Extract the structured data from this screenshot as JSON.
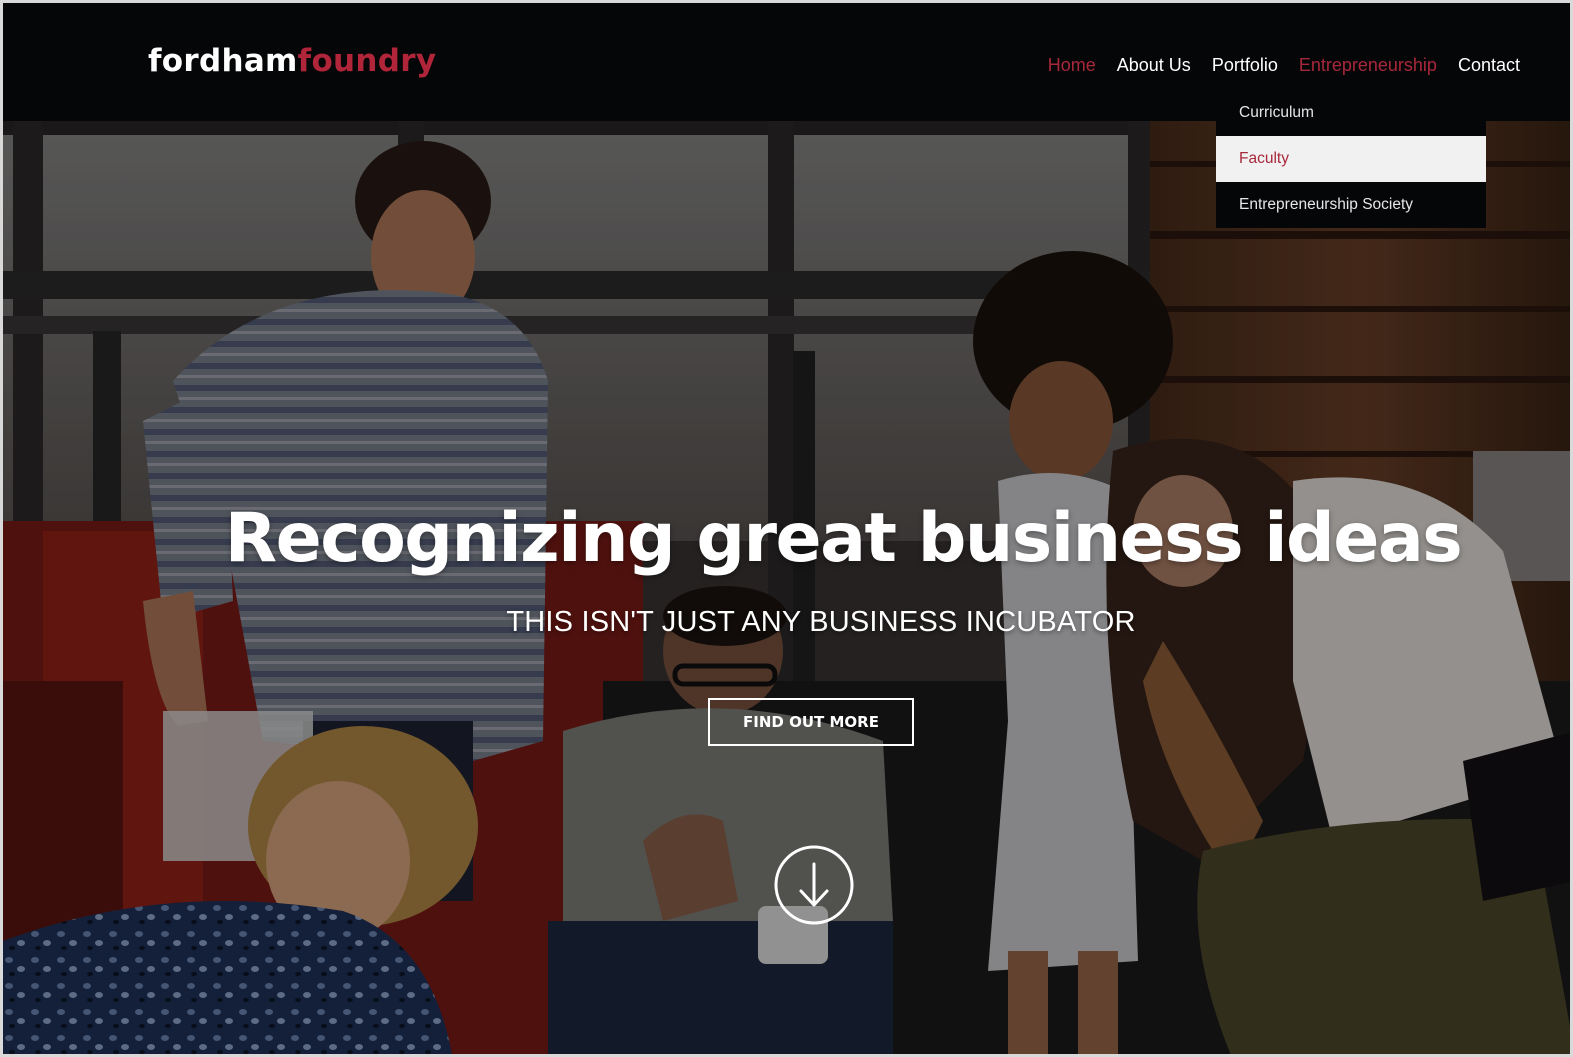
{
  "brand": {
    "name_part1": "fordham",
    "name_part2": "foundry",
    "color_primary": "#ffffff",
    "color_accent": "#b1253a"
  },
  "nav": {
    "items": [
      {
        "label": "Home",
        "state": "active"
      },
      {
        "label": "About Us",
        "state": "default"
      },
      {
        "label": "Portfolio",
        "state": "default"
      },
      {
        "label": "Entrepreneurship",
        "state": "active"
      },
      {
        "label": "Contact",
        "state": "default"
      }
    ],
    "active_color": "#a8283b"
  },
  "dropdown": {
    "parent": "Entrepreneurship",
    "items": [
      {
        "label": "Curriculum",
        "state": "default"
      },
      {
        "label": "Faculty",
        "state": "hover"
      },
      {
        "label": "Entrepreneurship Society",
        "state": "default"
      }
    ]
  },
  "hero": {
    "title": "Recognizing great business ideas",
    "subtitle": "THIS ISN'T JUST ANY BUSINESS INCUBATOR",
    "cta_label": "FIND OUT MORE",
    "scroll_icon": "arrow-down-circle-icon"
  }
}
